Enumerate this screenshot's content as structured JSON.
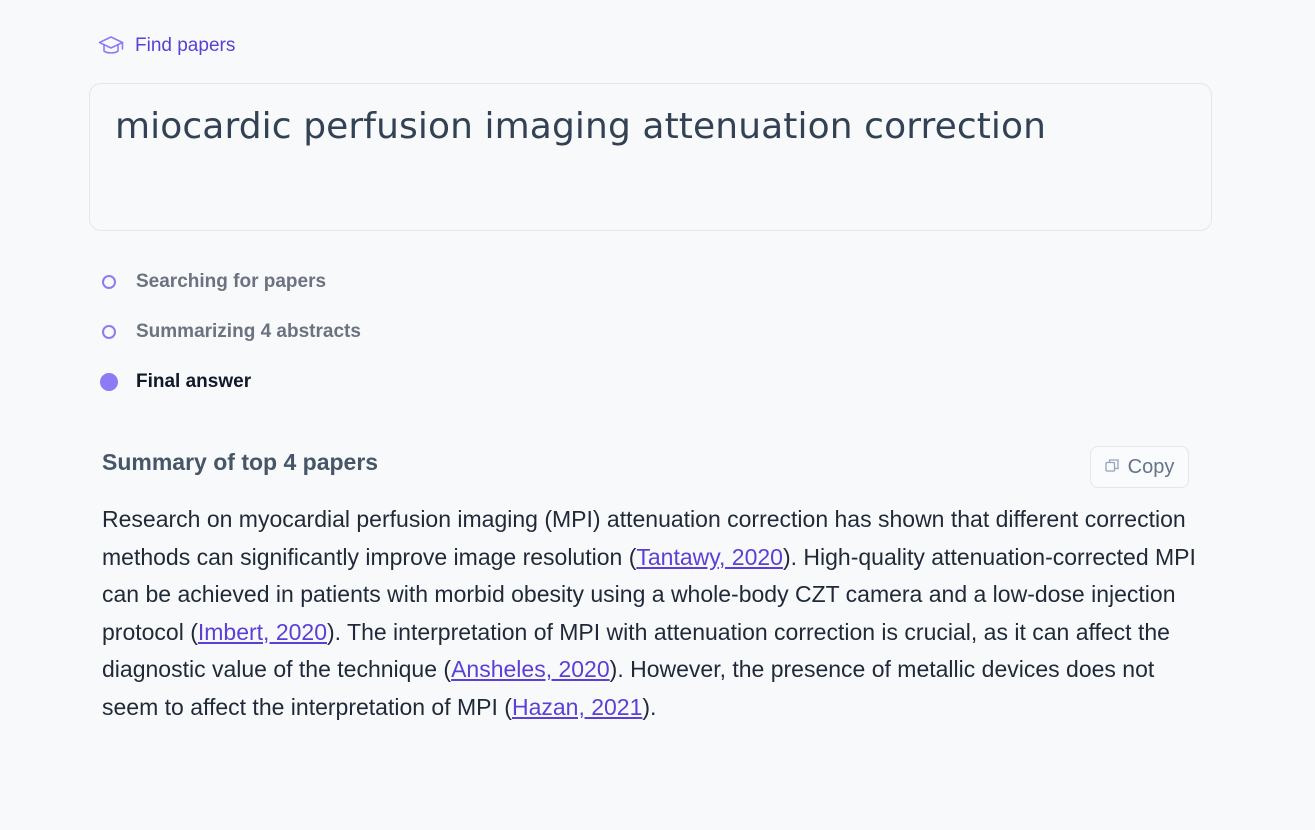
{
  "nav": {
    "find_papers_label": "Find papers",
    "icon": "graduation-cap-icon"
  },
  "query": {
    "text": "miocardic perfusion imaging attenuation correction"
  },
  "steps": [
    {
      "label": "Searching for papers",
      "state": "done"
    },
    {
      "label": "Summarizing 4 abstracts",
      "state": "done"
    },
    {
      "label": "Final answer",
      "state": "active"
    }
  ],
  "summary": {
    "title": "Summary of top 4 papers",
    "copy_label": "Copy",
    "parts": {
      "p1": "Research on myocardial perfusion imaging (MPI) attenuation correction has shown that different correction methods can significantly improve image resolution (",
      "c1": "Tantawy, 2020",
      "p2": "). High-quality attenuation-corrected MPI can be achieved in patients with morbid obesity using a whole-body CZT camera and a low-dose injection protocol (",
      "c2": "Imbert, 2020",
      "p3": "). The interpretation of MPI with attenuation correction is crucial, as it can affect the diagnostic value of the technique (",
      "c3": "Ansheles, 2020",
      "p4": "). However, the presence of metallic devices does not seem to affect the interpretation of MPI (",
      "c4": "Hazan, 2021",
      "p5": ")."
    }
  },
  "colors": {
    "accent": "#5b3fd6",
    "step_dot": "#8b7cf6",
    "background": "#f8f9fb"
  }
}
